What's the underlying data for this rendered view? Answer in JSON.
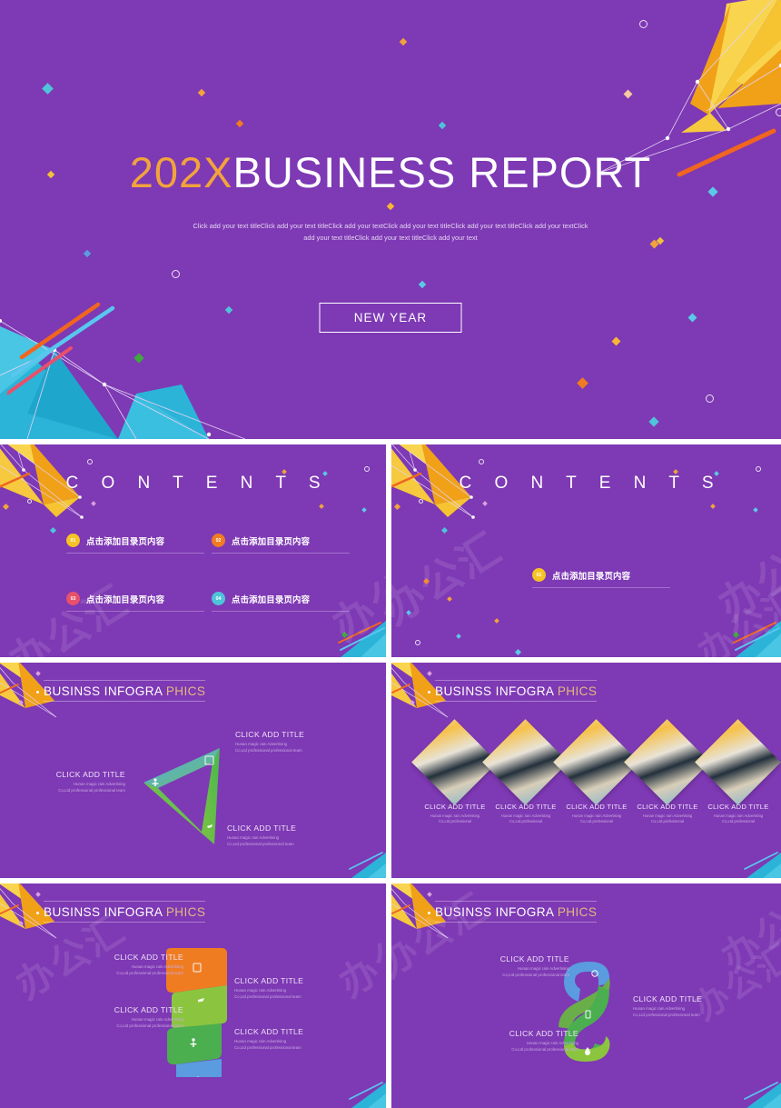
{
  "palette": {
    "purple_bg": "#7E39B4",
    "gold": "#F2A33C",
    "yellow": "#F6C324",
    "orange": "#F07C22",
    "red": "#E8506B",
    "cyan": "#4FC3D9",
    "blue": "#5B9BE0",
    "green": "#4BAE4F",
    "lightgreen": "#8BC53F",
    "accent_text": "#E0B980"
  },
  "watermark": {
    "text": "办公汇"
  },
  "cover": {
    "title_year": "202X",
    "title_main": "BUSINESS REPORT",
    "subtitle": "Click add your text titleClick add your text titleClick add your textClick add your text titleClick add your text titleClick add your textClick add your text titleClick add your text titleClick add your text",
    "button_label": "NEW YEAR"
  },
  "contents_full": {
    "title": "C O N T E N T S",
    "items": [
      {
        "num": "01",
        "label": "点击添加目录页内容",
        "color": "#F6C324"
      },
      {
        "num": "02",
        "label": "点击添加目录页内容",
        "color": "#F07C22"
      },
      {
        "num": "03",
        "label": "点击添加目录页内容",
        "color": "#E8506B"
      },
      {
        "num": "04",
        "label": "点击添加目录页内容",
        "color": "#4FC3D9"
      }
    ]
  },
  "contents_single": {
    "title": "C O N T E N T S",
    "items": [
      {
        "num": "01",
        "label": "点击添加目录页内容",
        "color": "#F6C324"
      }
    ]
  },
  "infographic_header": {
    "main": "BUSINSS INFOGRA ",
    "accent": "PHICS"
  },
  "triangle_slide": {
    "blocks": [
      {
        "title": "CLICK ADD TITLE",
        "line1": "Hunan magic rain Advertising",
        "line2": "Co,Ltd professional professional team",
        "icon": "building-icon"
      },
      {
        "title": "CLICK ADD TITLE",
        "line1": "Hunan magic rain Advertising",
        "line2": "Co,Ltd professional professional team",
        "icon": "person-icon"
      },
      {
        "title": "CLICK ADD TITLE",
        "line1": "Hunan magic rain Advertising",
        "line2": "Co,Ltd professional professional team",
        "icon": "plane-icon"
      }
    ]
  },
  "diamond_slide": {
    "cards": [
      {
        "title": "CLICK ADD TITLE",
        "line1": "Hunan magic rain Advertising",
        "line2": "Co,Ltd.professional"
      },
      {
        "title": "CLICK ADD TITLE",
        "line1": "Hunan magic rain Advertising",
        "line2": "Co,Ltd.professional"
      },
      {
        "title": "CLICK ADD TITLE",
        "line1": "Hunan magic rain Advertising",
        "line2": "Co,Ltd.professional"
      },
      {
        "title": "CLICK ADD TITLE",
        "line1": "Hunan magic rain Advertising",
        "line2": "Co,Ltd.professional"
      },
      {
        "title": "CLICK ADD TITLE",
        "line1": "Hunan magic rain Advertising",
        "line2": "Co,Ltd.professional"
      }
    ]
  },
  "ribbon_slide": {
    "blocks": [
      {
        "title": "CLICK ADD TITLE",
        "line1": "Hunan magic rain Advertising",
        "line2": "Co,Ltd professional professional team",
        "color": "#F07C22",
        "icon": "building-icon"
      },
      {
        "title": "CLICK ADD TITLE",
        "line1": "Hunan magic rain Advertising",
        "line2": "Co,Ltd professional professional team",
        "color": "#8BC53F",
        "icon": "plane-icon"
      },
      {
        "title": "CLICK ADD TITLE",
        "line1": "Hunan magic rain Advertising",
        "line2": "Co,Ltd professional professional team",
        "color": "#4BAE4F",
        "icon": "person-icon"
      },
      {
        "title": "CLICK ADD TITLE",
        "line1": "Hunan magic rain Advertising",
        "line2": "Co,Ltd professional professional team",
        "color": "#5B9BE0",
        "icon": "network-icon"
      }
    ]
  },
  "s_slide": {
    "blocks": [
      {
        "title": "CLICK ADD TITLE",
        "line1": "Hunan magic rain Advertising",
        "line2": "Co,Ltd professional professional team",
        "color": "#5B9BE0",
        "icon": "moon-icon"
      },
      {
        "title": "CLICK ADD TITLE",
        "line1": "Hunan magic rain Advertising",
        "line2": "Co,Ltd professional professional team",
        "color": "#4BAE4F",
        "icon": "mobile-icon"
      },
      {
        "title": "CLICK ADD TITLE",
        "line1": "Hunan magic rain Advertising",
        "line2": "Co,Ltd professional professional team",
        "color": "#8BC53F",
        "icon": "drop-icon"
      }
    ]
  }
}
